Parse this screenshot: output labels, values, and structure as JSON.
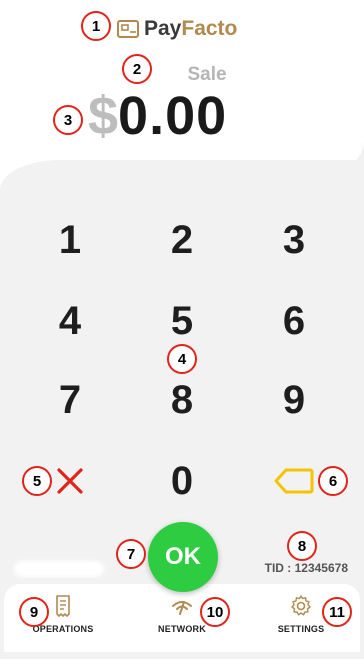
{
  "brand": {
    "name_part1": "Pay",
    "name_part2": "Facto",
    "accent_color": "#b08a4e"
  },
  "transaction": {
    "type_label": "Sale",
    "currency_symbol": "$",
    "amount": "0.00"
  },
  "keypad": {
    "keys": [
      "1",
      "2",
      "3",
      "4",
      "5",
      "6",
      "7",
      "8",
      "9",
      "0"
    ],
    "clear_icon": "x-icon",
    "backspace_icon": "backspace-icon",
    "clear_color": "#e2231a",
    "backspace_color": "#f5c400"
  },
  "actions": {
    "ok_label": "OK",
    "ok_color": "#2ecc40"
  },
  "terminal": {
    "tid_text": "TID : 12345678"
  },
  "bottom_nav": {
    "items": [
      {
        "label": "OPERATIONS",
        "icon": "receipt-icon"
      },
      {
        "label": "NETWORK",
        "icon": "signal-icon"
      },
      {
        "label": "SETTINGS",
        "icon": "gear-icon"
      }
    ]
  },
  "annotations": {
    "markers": [
      "1",
      "2",
      "3",
      "4",
      "5",
      "6",
      "7",
      "8",
      "9",
      "10",
      "11"
    ]
  }
}
